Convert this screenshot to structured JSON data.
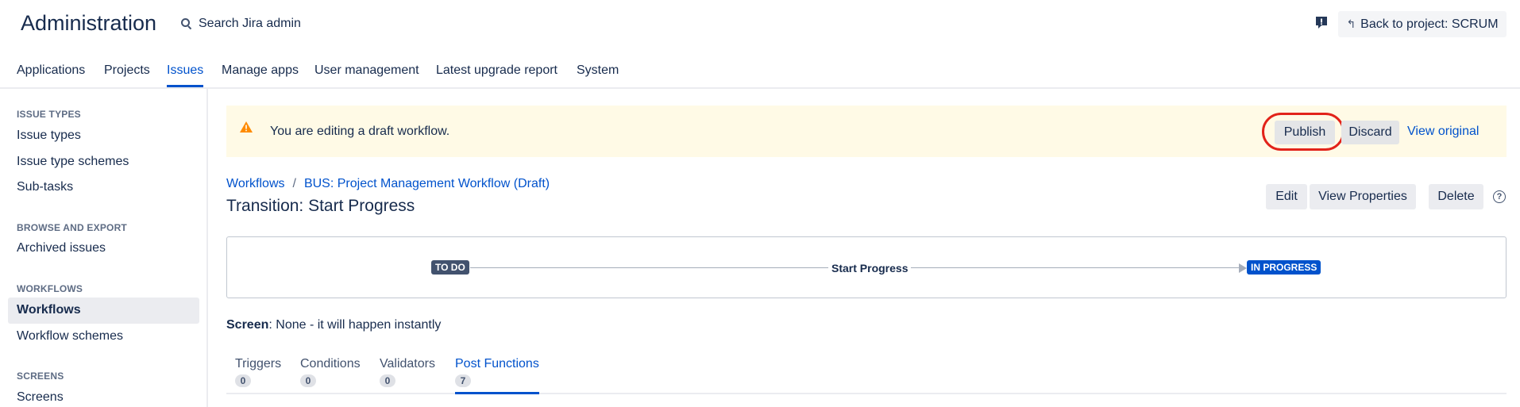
{
  "header": {
    "title": "Administration",
    "search_label": "Search Jira admin",
    "back_button": "Back to project: SCRUM"
  },
  "topnav": {
    "tabs": [
      {
        "label": "Applications"
      },
      {
        "label": "Projects"
      },
      {
        "label": "Issues",
        "active": true
      },
      {
        "label": "Manage apps"
      },
      {
        "label": "User management"
      },
      {
        "label": "Latest upgrade report"
      },
      {
        "label": "System"
      }
    ]
  },
  "sidebar": {
    "sections": [
      {
        "heading": "ISSUE TYPES",
        "items": [
          "Issue types",
          "Issue type schemes",
          "Sub-tasks"
        ]
      },
      {
        "heading": "BROWSE AND EXPORT",
        "items": [
          "Archived issues"
        ]
      },
      {
        "heading": "WORKFLOWS",
        "items": [
          "Workflows",
          "Workflow schemes"
        ]
      },
      {
        "heading": "SCREENS",
        "items": [
          "Screens"
        ]
      }
    ],
    "active_item": "Workflows"
  },
  "banner": {
    "message": "You are editing a draft workflow.",
    "publish": "Publish",
    "discard": "Discard",
    "view_original": "View original"
  },
  "breadcrumb": {
    "items": [
      "Workflows",
      "BUS: Project Management Workflow (Draft)"
    ],
    "separator": "/"
  },
  "page_title": "Transition: Start Progress",
  "actions": {
    "edit": "Edit",
    "view_properties": "View Properties",
    "delete": "Delete"
  },
  "diagram": {
    "from_status": "TO DO",
    "transition": "Start Progress",
    "to_status": "IN PROGRESS"
  },
  "screen": {
    "label": "Screen",
    "value": ": None - it will happen instantly"
  },
  "tabs": [
    {
      "label": "Triggers",
      "count": "0"
    },
    {
      "label": "Conditions",
      "count": "0"
    },
    {
      "label": "Validators",
      "count": "0"
    },
    {
      "label": "Post Functions",
      "count": "7",
      "active": true
    }
  ],
  "colors": {
    "brand_blue": "#0052CC",
    "banner_bg": "#FFFAE6",
    "warning": "#FF8B00",
    "highlight_ring": "#E2231A",
    "todo_lozenge": "#42526E",
    "inprogress_lozenge": "#0052CC"
  }
}
